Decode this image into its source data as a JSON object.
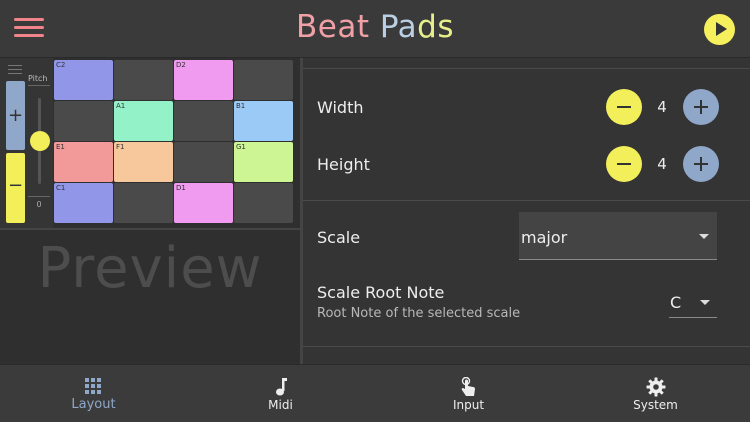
{
  "app": {
    "title_parts": [
      "Beat",
      " ",
      "Pads"
    ]
  },
  "colors": {
    "accent_yellow": "#f2ef5a",
    "accent_blue": "#8fa7c8",
    "title_pink": "#f0a0a6",
    "title_blue": "#b9cfe3",
    "title_yellow": "#e6ef8a"
  },
  "left_panel": {
    "pitch_label": "Pitch",
    "pitch_value": "0",
    "octave_up_label": "+",
    "octave_down_label": "−",
    "preview_label": "Preview",
    "pads": [
      {
        "note": "C2",
        "color": "#9196e8"
      },
      {
        "note": "",
        "color": "#4a4a4a"
      },
      {
        "note": "D2",
        "color": "#f09af0"
      },
      {
        "note": "",
        "color": "#4a4a4a"
      },
      {
        "note": "",
        "color": "#4a4a4a"
      },
      {
        "note": "A1",
        "color": "#93f2c8"
      },
      {
        "note": "",
        "color": "#4a4a4a"
      },
      {
        "note": "B1",
        "color": "#9ccaf7"
      },
      {
        "note": "E1",
        "color": "#f29a9a"
      },
      {
        "note": "F1",
        "color": "#f7c89c"
      },
      {
        "note": "",
        "color": "#4a4a4a"
      },
      {
        "note": "G1",
        "color": "#cdf594"
      },
      {
        "note": "C1",
        "color": "#9196e8"
      },
      {
        "note": "",
        "color": "#4a4a4a"
      },
      {
        "note": "D1",
        "color": "#f09af0"
      },
      {
        "note": "",
        "color": "#4a4a4a"
      }
    ]
  },
  "settings": {
    "width_label": "Width",
    "width_value": "4",
    "height_label": "Height",
    "height_value": "4",
    "scale_label": "Scale",
    "scale_value": "major",
    "root_label": "Scale Root Note",
    "root_sublabel": "Root Note of the selected scale",
    "root_value": "C"
  },
  "nav": {
    "items": [
      {
        "label": "Layout",
        "icon": "grid-icon",
        "active": true
      },
      {
        "label": "Midi",
        "icon": "music-note-icon",
        "active": false
      },
      {
        "label": "Input",
        "icon": "touch-icon",
        "active": false
      },
      {
        "label": "System",
        "icon": "gear-icon",
        "active": false
      }
    ]
  }
}
